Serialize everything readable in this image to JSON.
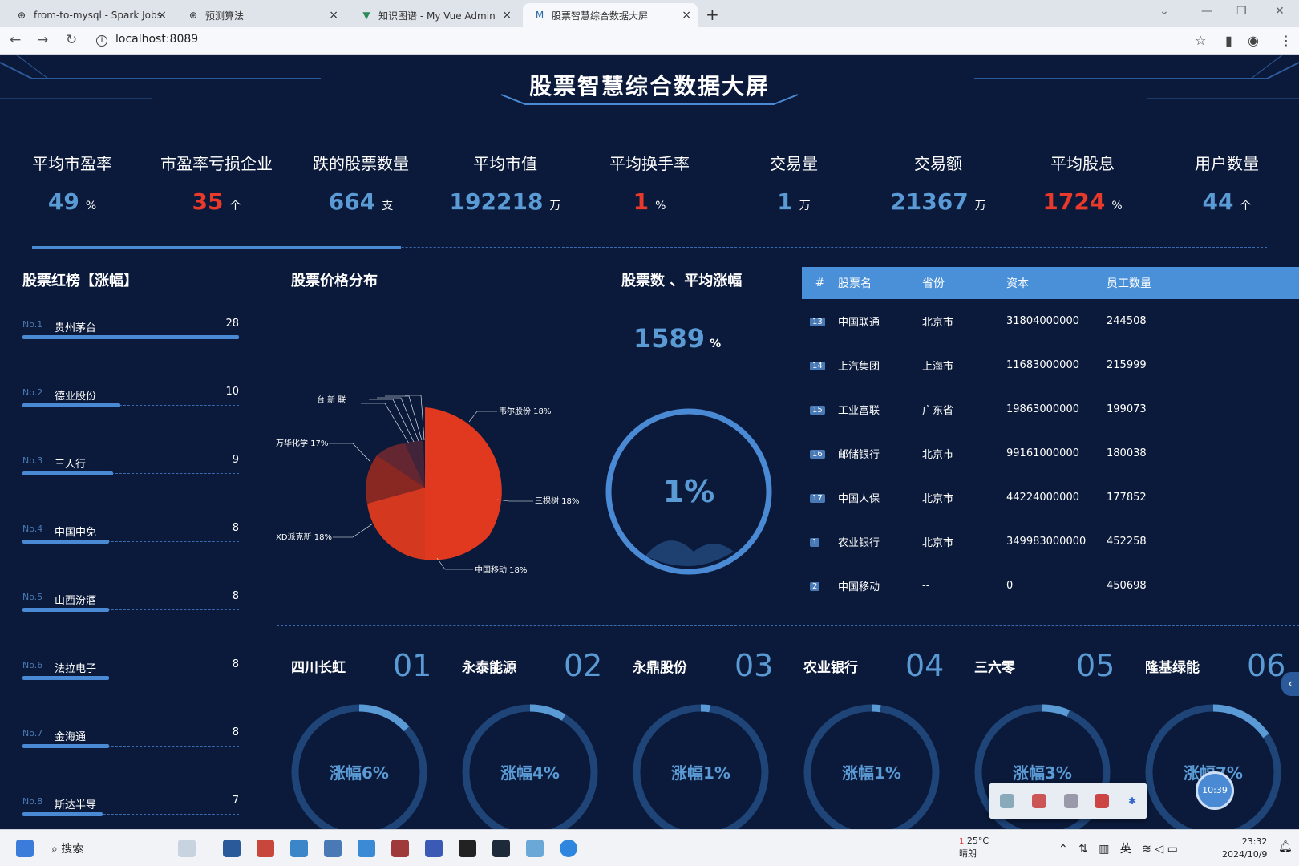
{
  "browser": {
    "tabs": [
      {
        "title": "from-to-mysql - Spark Jobs",
        "icon": "globe-icon"
      },
      {
        "title": "预测算法",
        "icon": "globe-icon"
      },
      {
        "title": "知识图谱 - My Vue Admin",
        "icon": "vue-icon"
      },
      {
        "title": "股票智慧综合数据大屏",
        "icon": "m-icon"
      }
    ],
    "url": "localhost:8089"
  },
  "dashboard": {
    "title": "股票智慧综合数据大屏",
    "stats": [
      {
        "label": "平均市盈率",
        "value": "49",
        "unit": "%",
        "color": "blue"
      },
      {
        "label": "市盈率亏损企业",
        "value": "35",
        "unit": "个",
        "color": "red"
      },
      {
        "label": "跌的股票数量",
        "value": "664",
        "unit": "支",
        "color": "blue"
      },
      {
        "label": "平均市值",
        "value": "192218",
        "unit": "万",
        "color": "blue"
      },
      {
        "label": "平均换手率",
        "value": "1",
        "unit": "%",
        "color": "red"
      },
      {
        "label": "交易量",
        "value": "1",
        "unit": "万",
        "color": "blue"
      },
      {
        "label": "交易额",
        "value": "21367",
        "unit": "万",
        "color": "blue"
      },
      {
        "label": "平均股息",
        "value": "1724",
        "unit": "%",
        "color": "red"
      },
      {
        "label": "用户数量",
        "value": "44",
        "unit": "个",
        "color": "blue"
      }
    ],
    "hot_title": "股票红榜【涨幅】",
    "hot_list": [
      {
        "no": "No.1",
        "name": "贵州茅台",
        "count": "28",
        "fill": 1.0
      },
      {
        "no": "No.2",
        "name": "德业股份",
        "count": "10",
        "fill": 0.45
      },
      {
        "no": "No.3",
        "name": "三人行",
        "count": "9",
        "fill": 0.42
      },
      {
        "no": "No.4",
        "name": "中国中免",
        "count": "8",
        "fill": 0.4
      },
      {
        "no": "No.5",
        "name": "山西汾酒",
        "count": "8",
        "fill": 0.4
      },
      {
        "no": "No.6",
        "name": "法拉电子",
        "count": "8",
        "fill": 0.4
      },
      {
        "no": "No.7",
        "name": "金海通",
        "count": "8",
        "fill": 0.4
      },
      {
        "no": "No.8",
        "name": "斯达半导",
        "count": "7",
        "fill": 0.37
      }
    ],
    "pie_title": "股票价格分布",
    "pie_labels": {
      "weier": "韦尔股份 18%",
      "sankeshu": "三棵树 18%",
      "zhongyidong": "中国移动 18%",
      "xd": "XD派克新 18%",
      "wanhua": "万华化学 17%",
      "small": "台 新 联"
    },
    "gauge_title": "股票数 、平均涨幅",
    "gauge_count": "1589",
    "gauge_count_unit": "%",
    "gauge_pct": "1%",
    "table": {
      "headers": [
        "#",
        "股票名",
        "省份",
        "资本",
        "员工数量"
      ],
      "rows": [
        {
          "rank": "13",
          "name": "中国联通",
          "province": "北京市",
          "capital": "31804000000",
          "staff": "244508"
        },
        {
          "rank": "14",
          "name": "上汽集团",
          "province": "上海市",
          "capital": "11683000000",
          "staff": "215999"
        },
        {
          "rank": "15",
          "name": "工业富联",
          "province": "广东省",
          "capital": "19863000000",
          "staff": "199073"
        },
        {
          "rank": "16",
          "name": "邮储银行",
          "province": "北京市",
          "capital": "99161000000",
          "staff": "180038"
        },
        {
          "rank": "17",
          "name": "中国人保",
          "province": "北京市",
          "capital": "44224000000",
          "staff": "177852"
        },
        {
          "rank": "1",
          "name": "农业银行",
          "province": "北京市",
          "capital": "349983000000",
          "staff": "452258"
        },
        {
          "rank": "2",
          "name": "中国移动",
          "province": "--",
          "capital": "0",
          "staff": "450698"
        }
      ]
    },
    "circle_stocks": [
      {
        "name": "四川长虹",
        "index": "01",
        "label": "涨幅6%",
        "pct": 0.06
      },
      {
        "name": "永泰能源",
        "index": "02",
        "label": "涨幅4%",
        "pct": 0.04
      },
      {
        "name": "永鼎股份",
        "index": "03",
        "label": "涨幅1%",
        "pct": 0.01
      },
      {
        "name": "农业银行",
        "index": "04",
        "label": "涨幅1%",
        "pct": 0.01
      },
      {
        "name": "三六零",
        "index": "05",
        "label": "涨幅3%",
        "pct": 0.03
      },
      {
        "name": "隆基绿能",
        "index": "06",
        "label": "涨幅7%",
        "pct": 0.07
      }
    ],
    "floating_clock": "10:39"
  },
  "taskbar": {
    "search": "搜索",
    "weather_temp": "25°C",
    "weather_desc": "晴朗",
    "weather_badge": "1",
    "ime": "英",
    "time": "23:32",
    "date": "2024/10/9"
  },
  "colors": {
    "accent": "#5b9bd5",
    "red": "#e8392a",
    "bg": "#0b1a3a",
    "table_header": "#4a90d9"
  }
}
